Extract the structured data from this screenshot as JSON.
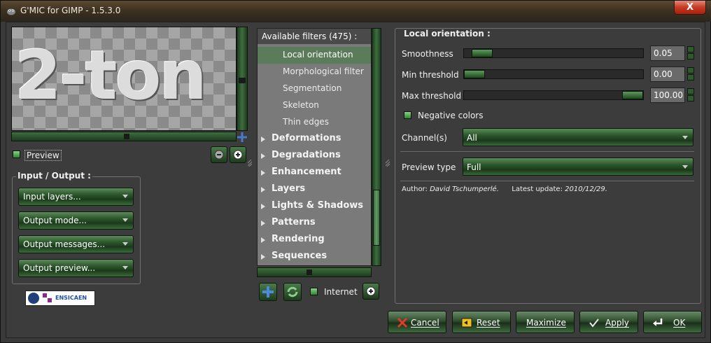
{
  "window": {
    "title": "G'MIC for GIMP - 1.5.3.0",
    "close": "X"
  },
  "preview": {
    "image_text": "2-ton",
    "checkbox_label": "Preview"
  },
  "io_panel": {
    "title": "Input / Output :",
    "buttons": [
      "Input layers...",
      "Output mode...",
      "Output messages...",
      "Output preview..."
    ]
  },
  "logo": {
    "text": "ENSICAEN"
  },
  "filters": {
    "header": "Available filters (475) :",
    "subitems": [
      "Local orientation",
      "Morphological filter",
      "Segmentation",
      "Skeleton",
      "Thin edges"
    ],
    "categories": [
      "Deformations",
      "Degradations",
      "Enhancement",
      "Layers",
      "Lights & Shadows",
      "Patterns",
      "Rendering",
      "Sequences"
    ],
    "internet_label": "Internet"
  },
  "params": {
    "title": "Local orientation :",
    "sliders": [
      {
        "label": "Smoothness",
        "value": "0.05",
        "fraction": 0.05
      },
      {
        "label": "Min threshold",
        "value": "0.00",
        "fraction": 0.0
      },
      {
        "label": "Max threshold",
        "value": "100.00",
        "fraction": 1.0
      }
    ],
    "negative_label": "Negative colors",
    "channels_label": "Channel(s)",
    "channels_value": "All",
    "preview_type_label": "Preview type",
    "preview_type_value": "Full",
    "author_label": "Author:",
    "author_name": "David Tschumperlé.",
    "update_label": "Latest update:",
    "update_date": "2010/12/29."
  },
  "actions": {
    "cancel": "Cancel",
    "reset": "Reset",
    "maximize": "Maximize",
    "apply": "Apply",
    "ok": "OK"
  },
  "colors": {
    "accent_green": "#2e5a2e",
    "selected": "#5a7c5a",
    "title_bar": "#3d3222",
    "close": "#c43a22"
  }
}
